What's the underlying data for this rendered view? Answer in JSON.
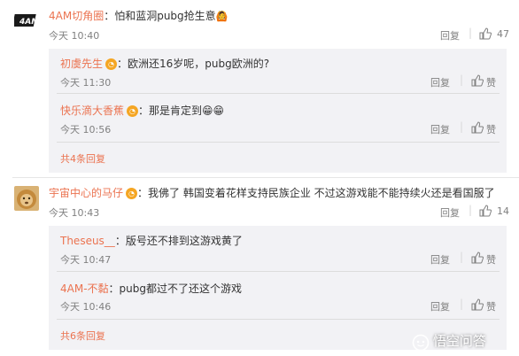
{
  "comments": [
    {
      "user": "4AM切角圈",
      "text": "：怕和蓝洞pubg抢生意",
      "time": "今天 10:40",
      "reply_label": "回复",
      "like_count": "47",
      "replies": [
        {
          "user": "初虞先生",
          "text": "：欧洲还16岁呢，pubg欧洲的?",
          "time": "今天 11:30",
          "reply_label": "回复",
          "like_label": "赞"
        },
        {
          "user": "快乐滴大香蕉",
          "text": "：那是肯定到",
          "time": "今天 10:56",
          "reply_label": "回复",
          "like_label": "赞"
        }
      ],
      "more_label": "共4条回复"
    },
    {
      "user": "宇宙中心的马仔",
      "text": "：我佛了 韩国变着花样支持民族企业  不过这游戏能不能持续火还是看国服了",
      "time": "今天 10:43",
      "reply_label": "回复",
      "like_count": "14",
      "replies": [
        {
          "user": "Theseus__",
          "text": "：版号还不排到这游戏黄了",
          "time": "今天 10:47",
          "reply_label": "回复",
          "like_label": "赞"
        },
        {
          "user": "4AM-不黏",
          "text": "：pubg都过不了还这个游戏",
          "time": "今天 10:46",
          "reply_label": "回复",
          "like_label": "赞"
        }
      ],
      "more_label": "共6条回复"
    }
  ],
  "watermark": "悟空问答",
  "avatar1_text": "4AM",
  "emoji": {
    "first_comment": "🙆",
    "banana": "😁😁"
  },
  "colors": {
    "username": "#eb7350",
    "meta": "#808080",
    "reply_bg": "#f2f2f5"
  }
}
